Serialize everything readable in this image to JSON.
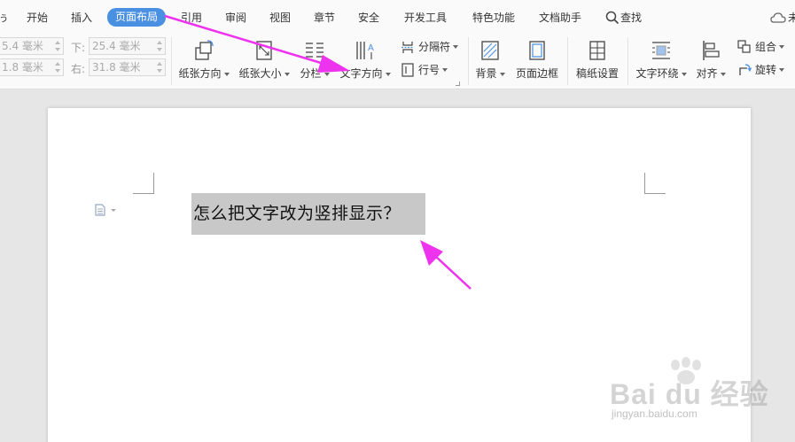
{
  "menu": {
    "items": [
      "ぅ",
      "开始",
      "插入",
      "页面布局",
      "引用",
      "审阅",
      "视图",
      "章节",
      "安全",
      "开发工具",
      "特色功能",
      "文档助手"
    ],
    "active": "页面布局",
    "search_label": "查找",
    "right_partial": "未"
  },
  "margins": {
    "top_value": "5.4 毫米",
    "left_value": "1.8 毫米",
    "bottom_label": "下:",
    "bottom_value": "25.4 毫米",
    "right_label": "右:",
    "right_value": "31.8 毫米"
  },
  "ribbon": {
    "orientation": "纸张方向",
    "size": "纸张大小",
    "columns": "分栏",
    "text_direction": "文字方向",
    "breaks": "分隔符",
    "line_numbers": "行号",
    "background": "背景",
    "page_border": "页面边框",
    "grid_paper": "稿纸设置",
    "text_wrap": "文字环绕",
    "align": "对齐",
    "group": "组合",
    "rotate": "旋转"
  },
  "document": {
    "text": "怎么把文字改为竖排显示？"
  },
  "watermark": {
    "brand": "Bai du 经验",
    "url": "jingyan.baidu.com"
  },
  "colors": {
    "accent": "#4a90e2",
    "annotation": "#ee33ee",
    "selection": "#c8c8c8"
  }
}
